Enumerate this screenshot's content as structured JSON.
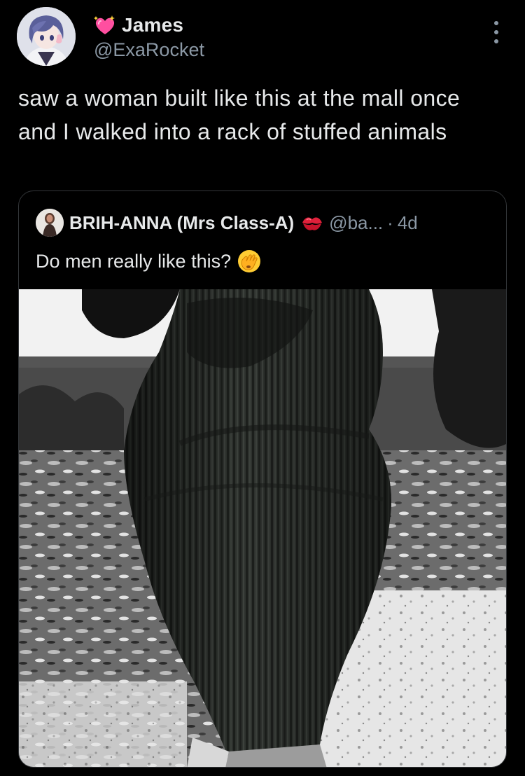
{
  "tweet": {
    "author": {
      "display_name": "James",
      "handle": "@ExaRocket",
      "name_badge_icon": "sparkling-heart-icon"
    },
    "text": "saw a woman built like this at the mall once and I walked into a rack of stuffed animals",
    "more_icon": "more-options-icon"
  },
  "quoted_tweet": {
    "author": {
      "display_name": "BRIH-ANNA (Mrs Class-A)",
      "name_emoji_icon": "kiss-mark-icon",
      "handle": "@ba...",
      "separator": "·",
      "time": "4d"
    },
    "text": "Do men really like this?",
    "text_emoji_icon": "face-with-peeking-eye-icon",
    "media_description_icon": "photo-media"
  },
  "colors": {
    "background": "#000000",
    "text_primary": "#e7e9ea",
    "text_secondary": "#8b98a5",
    "border": "#333639"
  }
}
